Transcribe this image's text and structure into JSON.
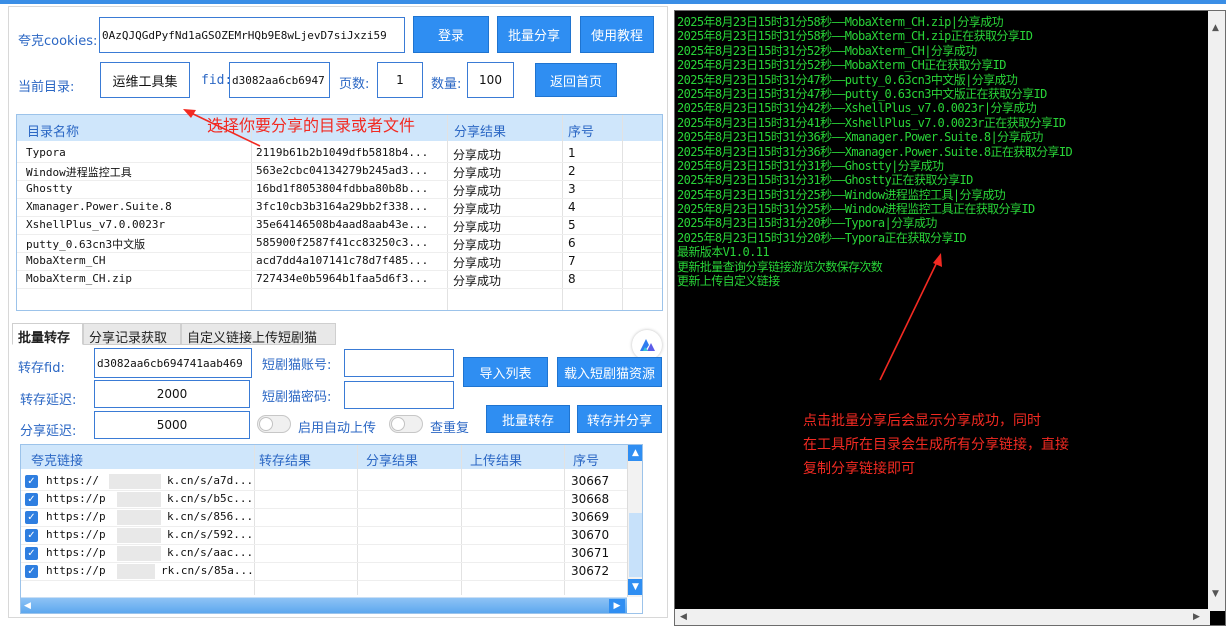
{
  "header": {
    "cookies_label": "夸克cookies:",
    "cookies_value": "0AzQJQGdPyfNd1aGSOZEMrHQb9E8wLjevD7siJxzi59",
    "login_label": "登录",
    "batch_share_label": "批量分享",
    "tutorial_label": "使用教程",
    "current_dir_label": "当前目录:",
    "current_dir_value": "运维工具集",
    "fid_label": "fid:",
    "fid_value": "d3082aa6cb6947",
    "page_label": "页数:",
    "page_value": "1",
    "count_label": "数量:",
    "count_value": "100",
    "home_label": "返回首页"
  },
  "annotation_top": "选择你要分享的目录或者文件",
  "dir_table": {
    "columns": [
      "目录名称",
      "分享结果",
      "序号"
    ],
    "rows": [
      {
        "name": "Typora",
        "link": "2119b61b2b1049dfb5818b4...",
        "result": "分享成功",
        "seq": "1"
      },
      {
        "name": "Window进程监控工具",
        "link": "563e2cbc04134279b245ad3...",
        "result": "分享成功",
        "seq": "2"
      },
      {
        "name": "Ghostty",
        "link": "16bd1f8053804fdbba80b8b...",
        "result": "分享成功",
        "seq": "3"
      },
      {
        "name": "Xmanager.Power.Suite.8",
        "link": "3fc10cb3b3164a29bb2f338...",
        "result": "分享成功",
        "seq": "4"
      },
      {
        "name": "XshellPlus_v7.0.0023r",
        "link": "35e64146508b4aad8aab43e...",
        "result": "分享成功",
        "seq": "5"
      },
      {
        "name": "putty_0.63cn3中文版",
        "link": "585900f2587f41cc83250c3...",
        "result": "分享成功",
        "seq": "6"
      },
      {
        "name": "MobaXterm_CH",
        "link": "acd7dd4a107141c78d7f485...",
        "result": "分享成功",
        "seq": "7"
      },
      {
        "name": "MobaXterm_CH.zip",
        "link": "727434e0b5964b1faa5d6f3...",
        "result": "分享成功",
        "seq": "8"
      }
    ]
  },
  "tabs": [
    "批量转存",
    "分享记录获取",
    "自定义链接上传短剧猫"
  ],
  "transfer": {
    "fid_label": "转存fid:",
    "fid_value": "d3082aa6cb694741aab469",
    "delay_label": "转存延迟:",
    "delay_value": "2000",
    "share_delay_label": "分享延迟:",
    "share_delay_value": "5000",
    "account_label": "短剧猫账号:",
    "password_label": "短剧猫密码:",
    "import_label": "导入列表",
    "load_label": "载入短剧猫资源",
    "auto_upload_label": "启用自动上传",
    "dedup_label": "查重复",
    "batch_transfer_label": "批量转存",
    "transfer_share_label": "转存并分享"
  },
  "links_table": {
    "columns": [
      "夸克链接",
      "转存结果",
      "分享结果",
      "上传结果",
      "序号"
    ],
    "rows": [
      {
        "url_a": "https://",
        "url_b": "k.cn/s/a7d...",
        "seq": "30667"
      },
      {
        "url_a": "https://p",
        "url_b": "k.cn/s/b5c...",
        "seq": "30668"
      },
      {
        "url_a": "https://p",
        "url_b": "k.cn/s/856...",
        "seq": "30669"
      },
      {
        "url_a": "https://p",
        "url_b": "k.cn/s/592...",
        "seq": "30670"
      },
      {
        "url_a": "https://p",
        "url_b": "k.cn/s/aac...",
        "seq": "30671"
      },
      {
        "url_a": "https://p",
        "url_b": "rk.cn/s/85a...",
        "seq": "30672"
      }
    ]
  },
  "terminal": {
    "lines": [
      "2025年8月23日15时31分58秒——MobaXterm_CH.zip|分享成功",
      "2025年8月23日15时31分58秒——MobaXterm_CH.zip正在获取分享ID",
      "2025年8月23日15时31分52秒——MobaXterm_CH|分享成功",
      "2025年8月23日15时31分52秒——MobaXterm_CH正在获取分享ID",
      "2025年8月23日15时31分47秒——putty_0.63cn3中文版|分享成功",
      "2025年8月23日15时31分47秒——putty_0.63cn3中文版正在获取分享ID",
      "2025年8月23日15时31分42秒——XshellPlus_v7.0.0023r|分享成功",
      "2025年8月23日15时31分41秒——XshellPlus_v7.0.0023r正在获取分享ID",
      "2025年8月23日15时31分36秒——Xmanager.Power.Suite.8|分享成功",
      "2025年8月23日15时31分36秒——Xmanager.Power.Suite.8正在获取分享ID",
      "2025年8月23日15时31分31秒——Ghostty|分享成功",
      "2025年8月23日15时31分31秒——Ghostty正在获取分享ID",
      "2025年8月23日15时31分25秒——Window进程监控工具|分享成功",
      "2025年8月23日15时31分25秒——Window进程监控工具正在获取分享ID",
      "2025年8月23日15时31分20秒——Typora|分享成功",
      "2025年8月23日15时31分20秒——Typora正在获取分享ID",
      "最新版本V1.0.11",
      "更新批量查询分享链接游览次数保存次数",
      "更新上传自定义链接"
    ]
  },
  "annotation_bottom": [
    "点击批量分享后会显示分享成功，同时",
    "在工具所在目录会生成所有分享链接，直接",
    "复制分享链接即可"
  ],
  "colors": {
    "accent_blue": "#2f8ef2",
    "terminal_green": "#29d438",
    "annotation_red": "#f22a22"
  }
}
